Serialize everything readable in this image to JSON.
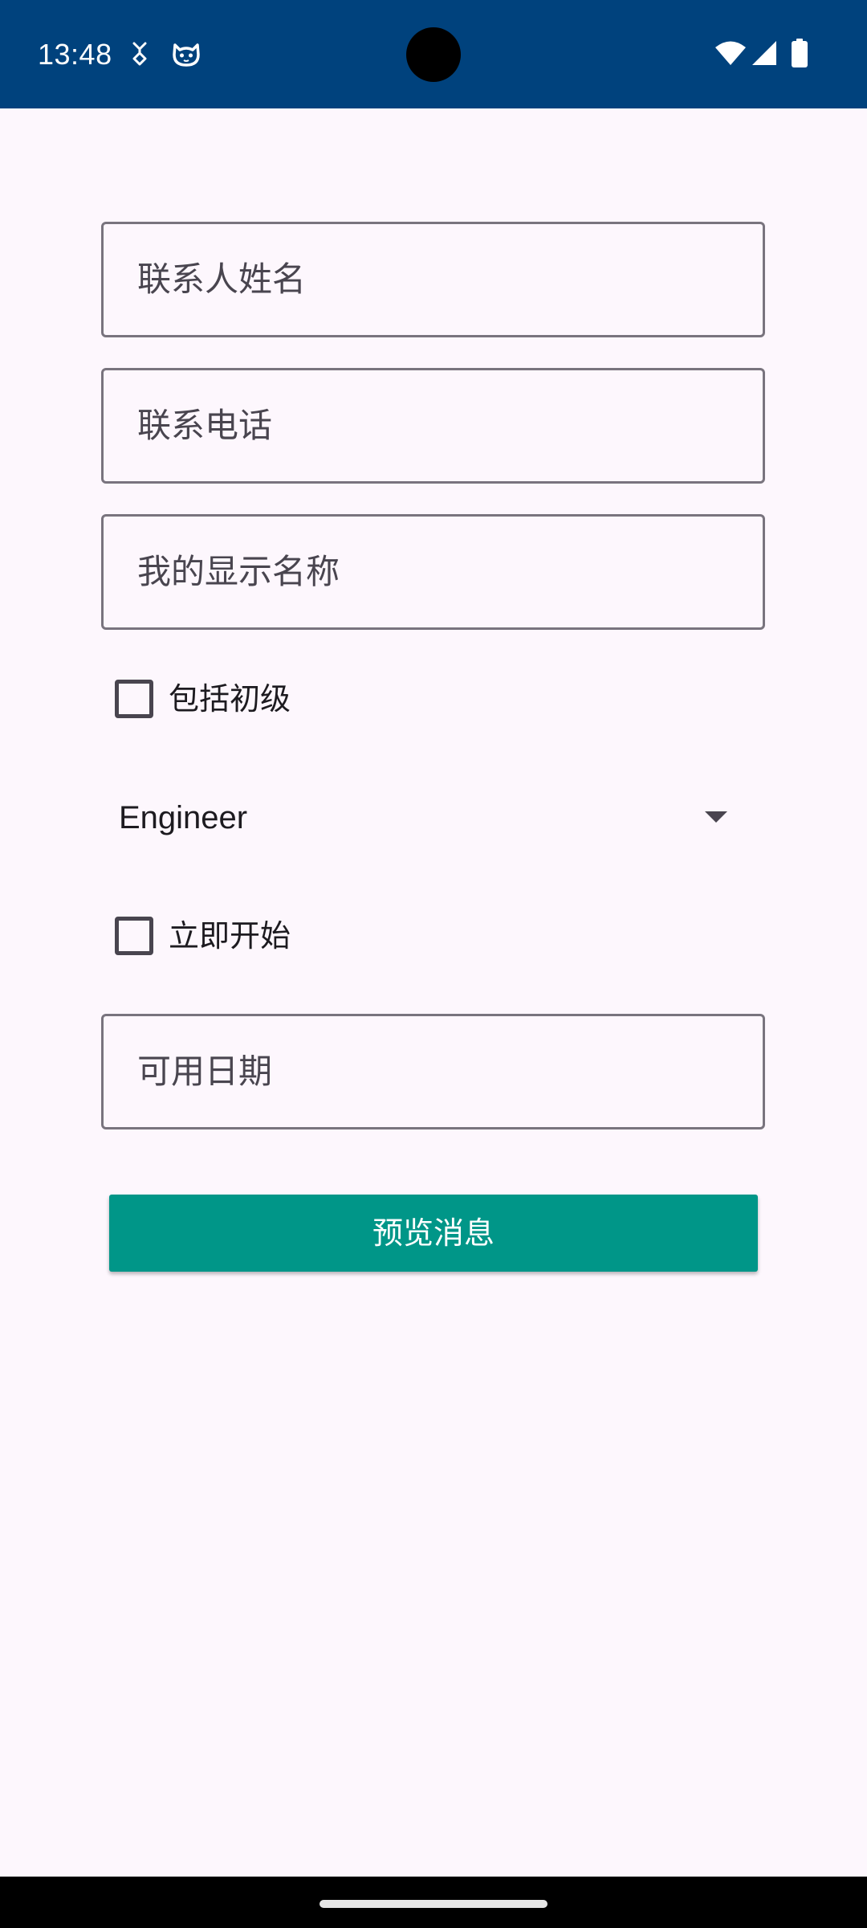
{
  "status_bar": {
    "time": "13:48",
    "left_icons": [
      "usb-debug-icon",
      "cat-notification-icon"
    ],
    "right_icons": [
      "wifi-icon",
      "cellular-signal-icon",
      "battery-icon"
    ],
    "background_color": "#00427D"
  },
  "form": {
    "contact_name": {
      "placeholder": "联系人姓名",
      "value": ""
    },
    "contact_phone": {
      "placeholder": "联系电话",
      "value": ""
    },
    "display_name": {
      "placeholder": "我的显示名称",
      "value": ""
    },
    "include_junior": {
      "label": "包括初级",
      "checked": false
    },
    "role_dropdown": {
      "selected": "Engineer"
    },
    "start_immediately": {
      "label": "立即开始",
      "checked": false
    },
    "available_date": {
      "placeholder": "可用日期",
      "value": ""
    },
    "preview_button": {
      "label": "预览消息",
      "color": "#009688"
    }
  },
  "colors": {
    "background": "#FDF7FD",
    "field_border": "#79747E",
    "accent": "#009688"
  }
}
